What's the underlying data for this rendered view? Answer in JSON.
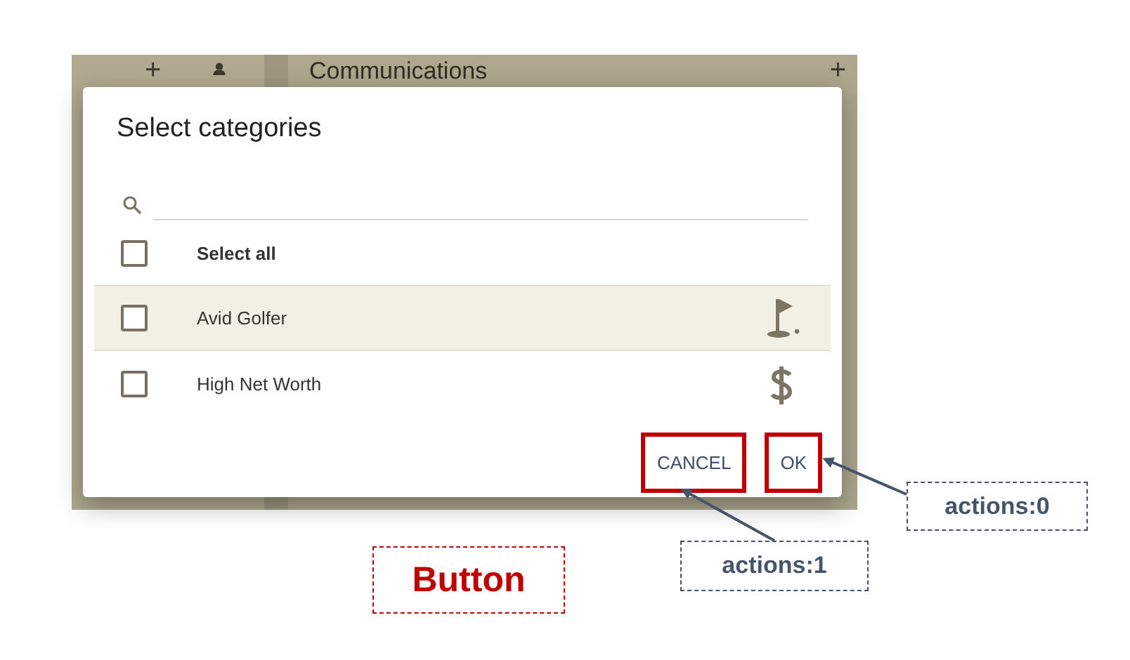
{
  "background_app": {
    "header_title": "Communications",
    "add_buttons": [
      "+",
      "+"
    ]
  },
  "dialog": {
    "title": "Select categories",
    "select_all": {
      "label": "Select all",
      "checked": false
    },
    "categories": [
      {
        "label": "Avid Golfer",
        "checked": false,
        "selected": true,
        "kind": "golf"
      },
      {
        "label": "High Net Worth",
        "checked": false,
        "selected": false,
        "kind": "money"
      }
    ],
    "actions": [
      {
        "label": "CANCEL",
        "highlighted": true
      },
      {
        "label": "OK",
        "highlighted": true
      }
    ]
  },
  "callouts": [
    {
      "label": "actions:0"
    },
    {
      "label": "actions:1"
    }
  ],
  "caption": "Button"
}
